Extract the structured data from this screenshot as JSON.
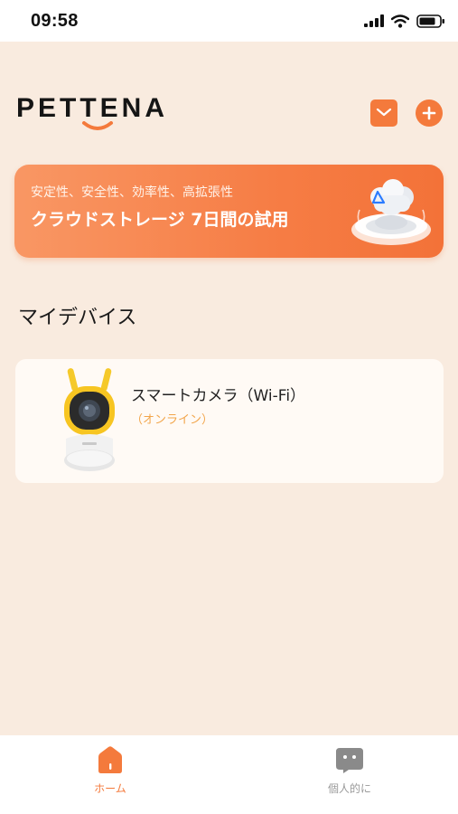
{
  "status_bar": {
    "time": "09:58",
    "icons": [
      "signal-icon",
      "wifi-icon",
      "battery-icon"
    ]
  },
  "header": {
    "brand": "PETTENA",
    "icons": [
      "mail-icon",
      "plus-icon"
    ]
  },
  "banner": {
    "subtitle": "安定性、安全性、効率性、高拡張性",
    "title": "クラウドストレージ 7日間の試用"
  },
  "devices": {
    "title": "マイデバイス",
    "items": [
      {
        "name": "スマートカメラ（Wi-Fi）",
        "status": "（オンライン）"
      }
    ]
  },
  "tabs": [
    {
      "label": "ホーム",
      "icon": "home-icon",
      "active": true
    },
    {
      "label": "個人的に",
      "icon": "chat-bubble-icon",
      "active": false
    }
  ],
  "colors": {
    "accent": "#f47a3c",
    "background": "#f9ebdf",
    "card": "#fffaf5",
    "online": "#f2a54a",
    "inactive": "#999999"
  }
}
